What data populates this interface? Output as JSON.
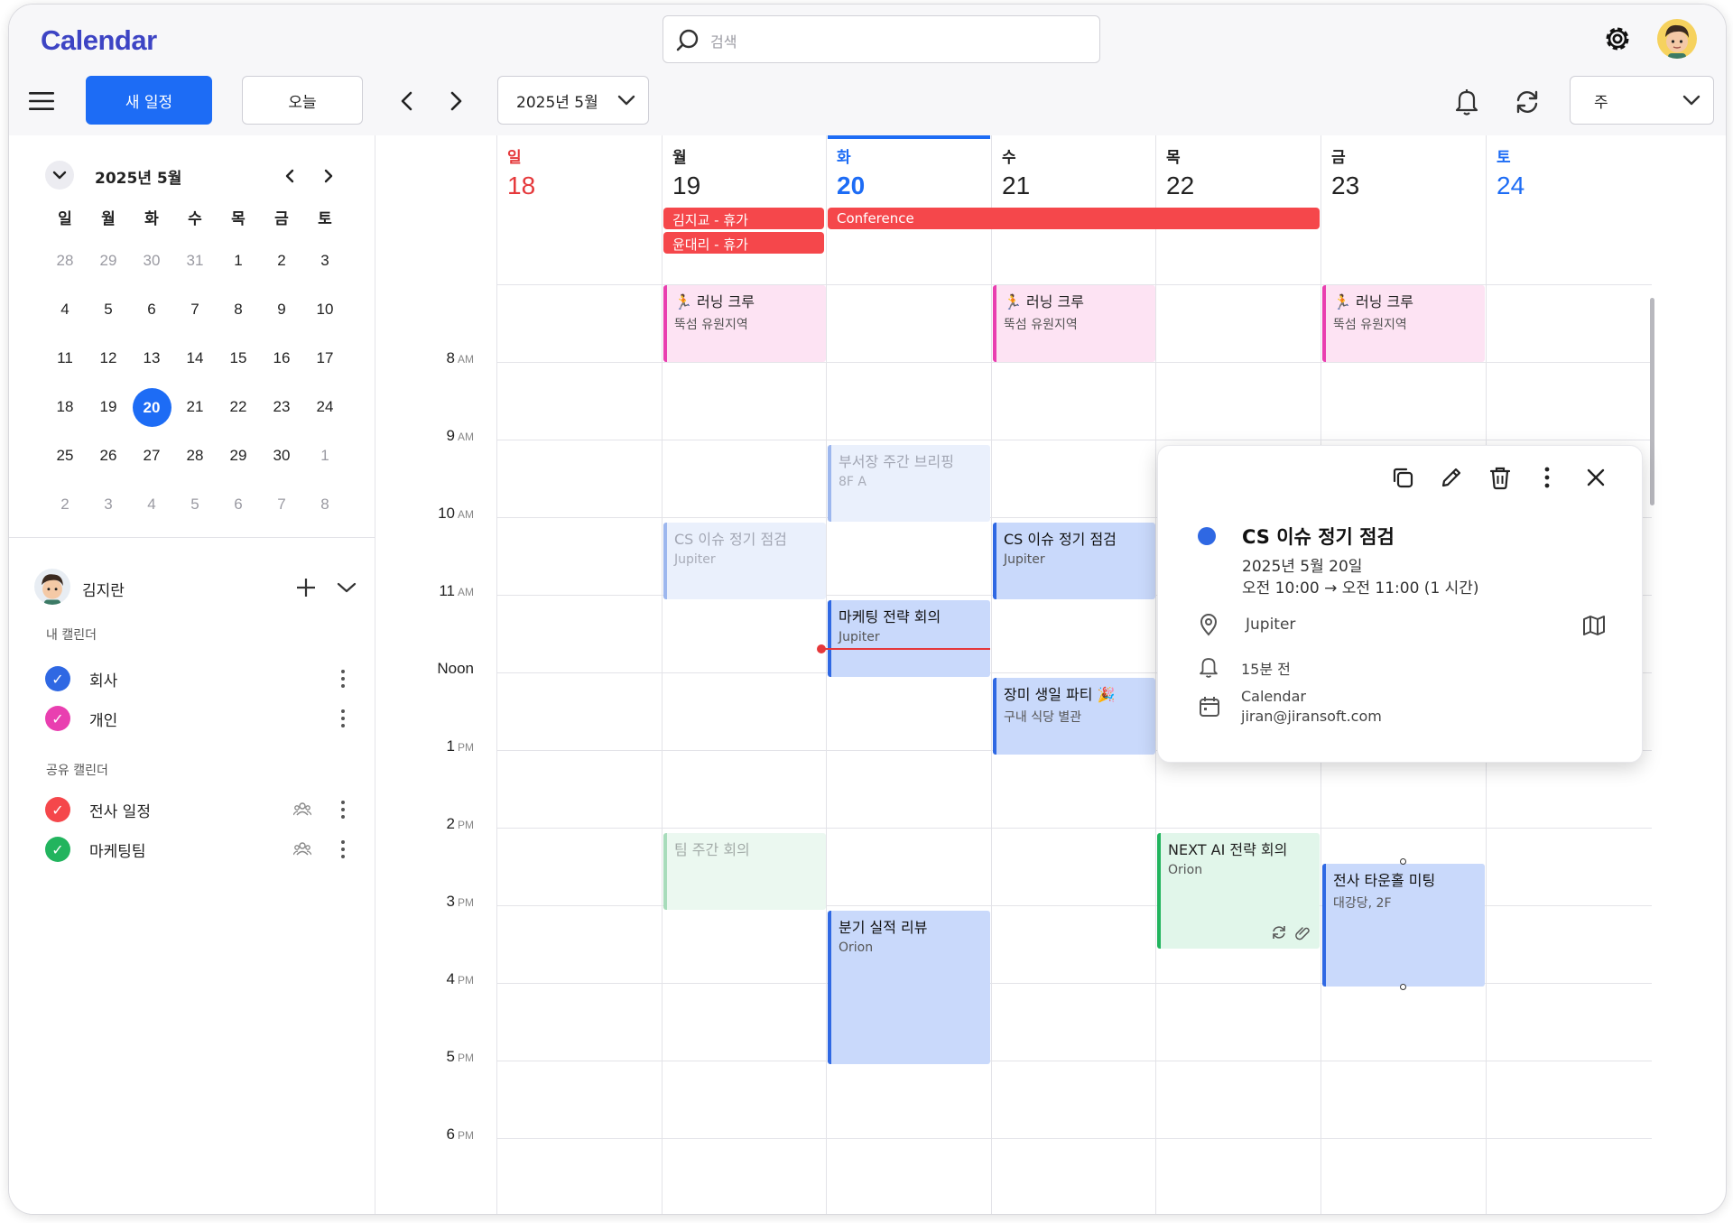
{
  "app": {
    "title": "Calendar"
  },
  "search": {
    "placeholder": "검색"
  },
  "toolbar": {
    "new_event": "새 일정",
    "today": "오늘",
    "month_label": "2025년 5월",
    "view": "주"
  },
  "mini_calendar": {
    "title": "2025년 5월",
    "weekdays": [
      "일",
      "월",
      "화",
      "수",
      "목",
      "금",
      "토"
    ],
    "weeks": [
      [
        "28",
        "29",
        "30",
        "31",
        "1",
        "2",
        "3"
      ],
      [
        "4",
        "5",
        "6",
        "7",
        "8",
        "9",
        "10"
      ],
      [
        "11",
        "12",
        "13",
        "14",
        "15",
        "16",
        "17"
      ],
      [
        "18",
        "19",
        "20",
        "21",
        "22",
        "23",
        "24"
      ],
      [
        "25",
        "26",
        "27",
        "28",
        "29",
        "30",
        "1"
      ],
      [
        "2",
        "3",
        "4",
        "5",
        "6",
        "7",
        "8"
      ]
    ],
    "selected": "20"
  },
  "user": {
    "name": "김지란"
  },
  "calendars": {
    "my_header": "내 캘린더",
    "shared_header": "공유 캘린더",
    "my": [
      {
        "label": "회사",
        "color": "#2f68e3"
      },
      {
        "label": "개인",
        "color": "#e93fb0"
      }
    ],
    "shared": [
      {
        "label": "전사 일정",
        "color": "#f5474b"
      },
      {
        "label": "마케팅팀",
        "color": "#22b45e"
      }
    ]
  },
  "week": {
    "days": [
      {
        "dow": "일",
        "num": "18",
        "color": "#e5383b"
      },
      {
        "dow": "월",
        "num": "19",
        "color": "#222222"
      },
      {
        "dow": "화",
        "num": "20",
        "color": "#1d6cf5"
      },
      {
        "dow": "수",
        "num": "21",
        "color": "#222222"
      },
      {
        "dow": "목",
        "num": "22",
        "color": "#222222"
      },
      {
        "dow": "금",
        "num": "23",
        "color": "#222222"
      },
      {
        "dow": "토",
        "num": "24",
        "color": "#1d6cf5"
      }
    ],
    "times": [
      {
        "h": "8",
        "p": "AM"
      },
      {
        "h": "9",
        "p": "AM"
      },
      {
        "h": "10",
        "p": "AM"
      },
      {
        "h": "11",
        "p": "AM"
      },
      {
        "h": "Noon",
        "p": ""
      },
      {
        "h": "1",
        "p": "PM"
      },
      {
        "h": "2",
        "p": "PM"
      },
      {
        "h": "3",
        "p": "PM"
      },
      {
        "h": "4",
        "p": "PM"
      },
      {
        "h": "5",
        "p": "PM"
      },
      {
        "h": "6",
        "p": "PM"
      }
    ],
    "all_day": {
      "vacation1": "김지교 - 휴가",
      "vacation2": "윤대리 - 휴가",
      "conference": "Conference"
    },
    "events": {
      "running_title": "러닝 크루",
      "running_loc": "뚝섬 유원지역",
      "briefing_title": "부서장 주간 브리핑",
      "briefing_loc": "8F A",
      "cs_title": "CS 이슈 정기 점검",
      "cs_loc": "Jupiter",
      "marketing_title": "마케팅 전략 회의",
      "marketing_loc": "Jupiter",
      "party_title": "장미 생일 파티 🎉",
      "party_loc": "구내 식당 별관",
      "team_title": "팀 주간 회의",
      "ai_title": "NEXT AI 전략 회의",
      "ai_loc": "Orion",
      "townhall_title": "전사 타운홀 미팅",
      "townhall_loc": "대강당, 2F",
      "review_title": "분기 실적 리뷰",
      "review_loc": "Orion"
    }
  },
  "popup": {
    "title": "CS 이슈 정기 점검",
    "date": "2025년 5월 20일",
    "time": "오전 10:00 → 오전 11:00 (1 시간)",
    "location": "Jupiter",
    "reminder": "15분 전",
    "calendar_name": "Calendar",
    "calendar_owner": "jiran@jiransoft.com",
    "dot_color": "#2f68e3"
  }
}
